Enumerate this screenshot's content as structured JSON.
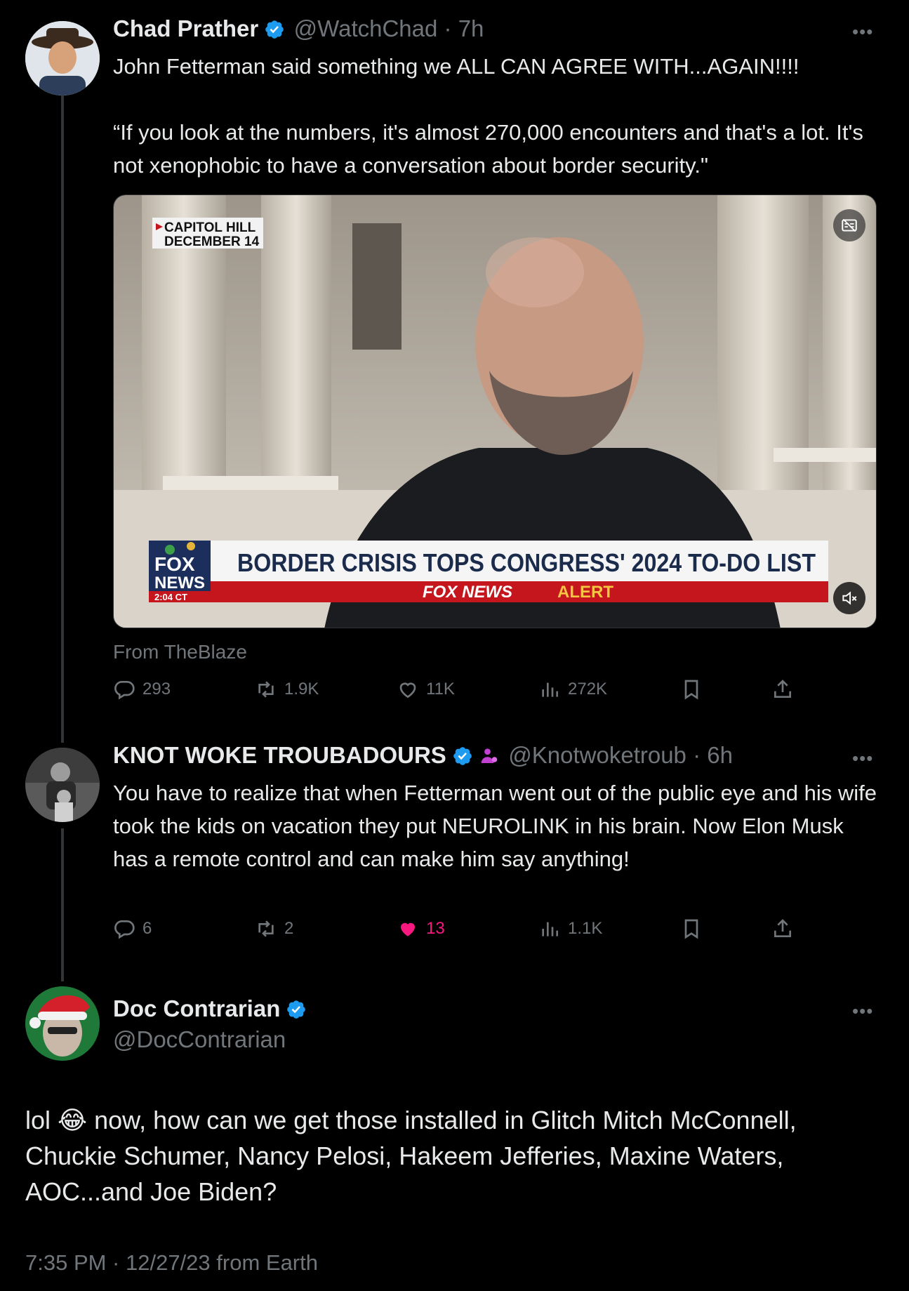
{
  "tweet1": {
    "name": "Chad Prather",
    "handle": "@WatchChad",
    "time": "7h",
    "text": "John Fetterman said something we ALL CAN AGREE WITH...AGAIN!!!!\n\n“If you look at the numbers, it's almost 270,000 encounters and that's a lot. It's not xenophobic to have a conversation about border security.\"",
    "media": {
      "location_line1": "CAPITOL HILL",
      "location_line2": "DECEMBER 14",
      "chyron": "BORDER CRISIS TOPS CONGRESS' 2024 TO-DO LIST",
      "network_line1": "FOX",
      "network_line2": "NEWS",
      "clock": "2:04 CT",
      "alert_prefix": "FOX NEWS",
      "alert_word": "ALERT"
    },
    "source": "From TheBlaze",
    "replies": "293",
    "reposts": "1.9K",
    "likes": "11K",
    "views": "272K"
  },
  "tweet2": {
    "name": "KNOT WOKE TROUBADOURS",
    "handle": "@Knotwoketroub",
    "time": "6h",
    "text": "You have to realize that when Fetterman went out of the public eye and his wife took the kids on vacation they put NEUROLINK in his brain. Now Elon Musk has a remote control and can make him say anything!",
    "replies": "6",
    "reposts": "2",
    "likes": "13",
    "views": "1.1K"
  },
  "tweet3": {
    "name": "Doc Contrarian",
    "handle": "@DocContrarian",
    "text_before_emoji": "lol",
    "emoji": "😂",
    "text_after_emoji": " now, how can we get those installed in Glitch Mitch McConnell, Chuckie Schumer, Nancy Pelosi, Hakeem Jefferies, Maxine Waters, AOC...and Joe Biden?",
    "timestamp": "7:35 PM · 12/27/23 from Earth"
  },
  "colors": {
    "verified": "#1d9bf0",
    "liked": "#f91880",
    "secondary": "#71767b",
    "text": "#e7e9ea"
  },
  "icons": [
    "verified-badge-icon",
    "more-icon",
    "reply-icon",
    "repost-icon",
    "like-icon",
    "views-icon",
    "bookmark-icon",
    "share-icon",
    "mute-icon",
    "captions-icon"
  ]
}
